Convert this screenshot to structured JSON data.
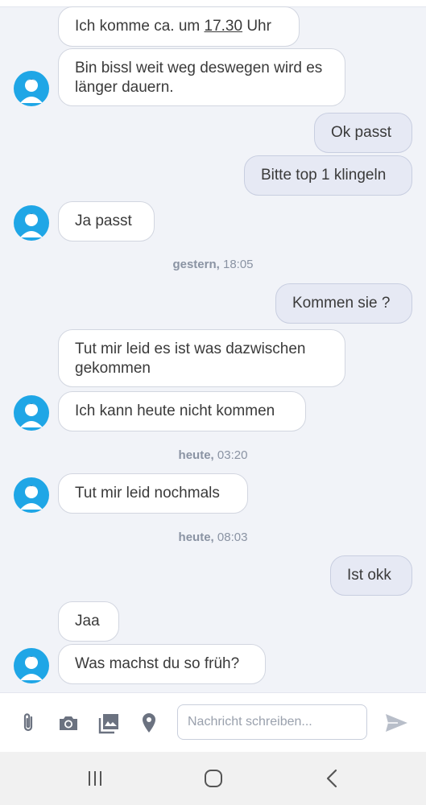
{
  "messages": {
    "m1": {
      "before": "Ich komme ca. um ",
      "underlined": "17.30",
      "after": " Uhr"
    },
    "m2": "Bin bissl weit weg deswegen wird es länger dauern.",
    "m3": "Ok passt",
    "m4": "Bitte top 1 klingeln",
    "m5": "Ja passt",
    "m6": "Kommen sie ?",
    "m7": "Tut mir leid es ist was dazwischen gekommen",
    "m8": "Ich kann heute nicht kommen",
    "m9": "Tut mir leid nochmals",
    "m10": "Ist okk",
    "m11": "Jaa",
    "m12": "Was machst du so früh?"
  },
  "timestamps": {
    "t1": {
      "day": "gestern,",
      "time": " 18:05"
    },
    "t2": {
      "day": "heute,",
      "time": " 03:20"
    },
    "t3": {
      "day": "heute,",
      "time": " 08:03"
    }
  },
  "composer": {
    "placeholder": "Nachricht schreiben..."
  },
  "icons": {
    "attach": "paperclip-icon",
    "camera": "camera-icon",
    "gallery": "image-icon",
    "location": "location-pin-icon",
    "send": "send-icon",
    "avatar": "user-avatar-icon"
  },
  "colors": {
    "background": "#f1f3f8",
    "incoming_bubble": "#ffffff",
    "outgoing_bubble": "#e6e9f4",
    "avatar": "#1fa6e6",
    "icon_gray": "#6b7280"
  }
}
